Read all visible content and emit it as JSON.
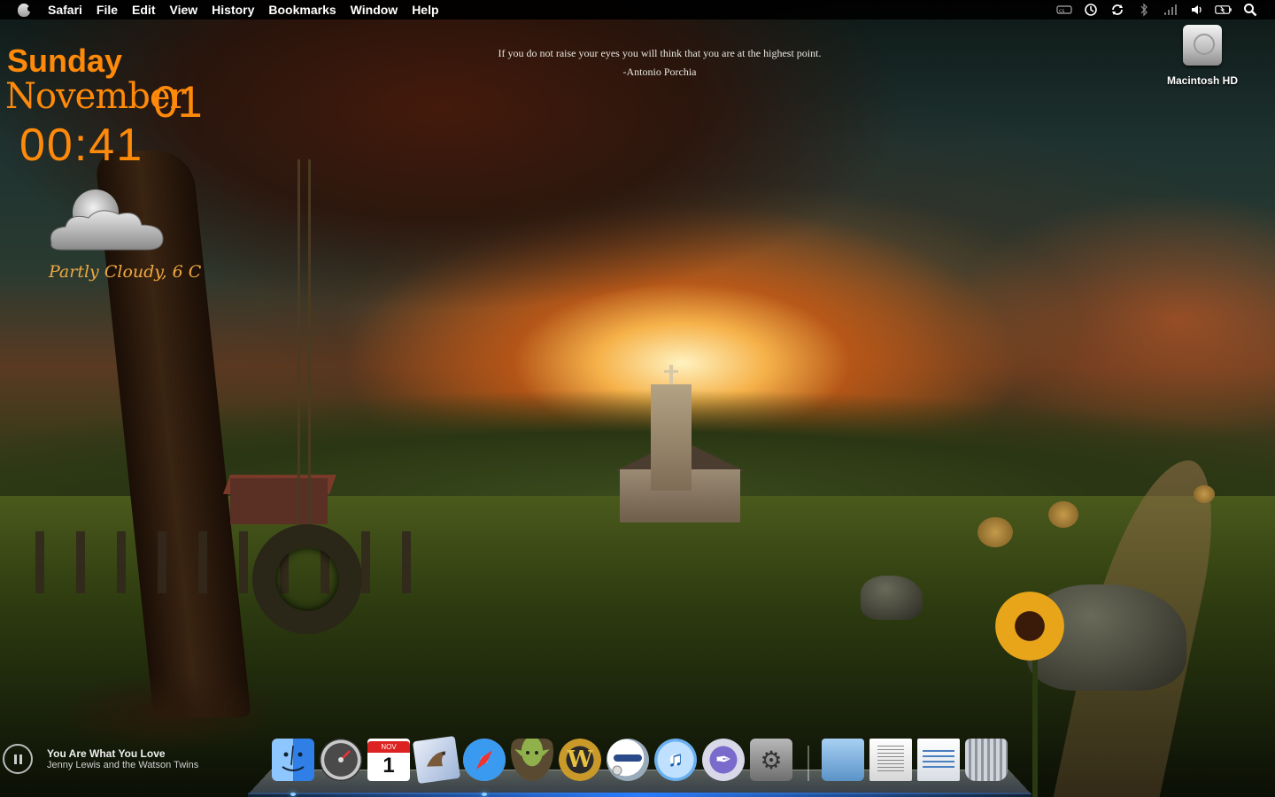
{
  "menubar": {
    "app_name": "Safari",
    "items": [
      "File",
      "Edit",
      "View",
      "History",
      "Bookmarks",
      "Window",
      "Help"
    ],
    "status_icons": [
      "adobe-cs-icon",
      "time-machine-icon",
      "sync-icon",
      "bluetooth-icon",
      "wifi-icon",
      "volume-icon",
      "battery-icon",
      "spotlight-icon"
    ]
  },
  "clock": {
    "day": "Sunday",
    "month": "November",
    "date": "01",
    "time": "00:41"
  },
  "weather": {
    "condition": "Partly Cloudy, 6 C",
    "icon": "partly-cloudy-icon"
  },
  "quote": {
    "text": "If you do not raise your eyes you will think that you are at the highest point.",
    "author": "-Antonio Porchia"
  },
  "desktop": {
    "drive_label": "Macintosh HD"
  },
  "now_playing": {
    "title": "You Are What You Love",
    "artist": "Jenny Lewis and the Watson Twins",
    "state": "paused"
  },
  "dock": {
    "calendar_month": "NOV",
    "calendar_day": "1",
    "wow_letter": "W",
    "itunes_glyph": "♫",
    "quill_glyph": "✒",
    "prefs_glyph": "⚙",
    "apps": [
      "Finder",
      "Dashboard",
      "iCal",
      "Mail",
      "Safari",
      "Yoda",
      "World of Warcraft",
      "iChat",
      "iTunes",
      "Script Editor",
      "System Preferences",
      "Applications",
      "Documents",
      "Downloads",
      "Trash"
    ]
  }
}
